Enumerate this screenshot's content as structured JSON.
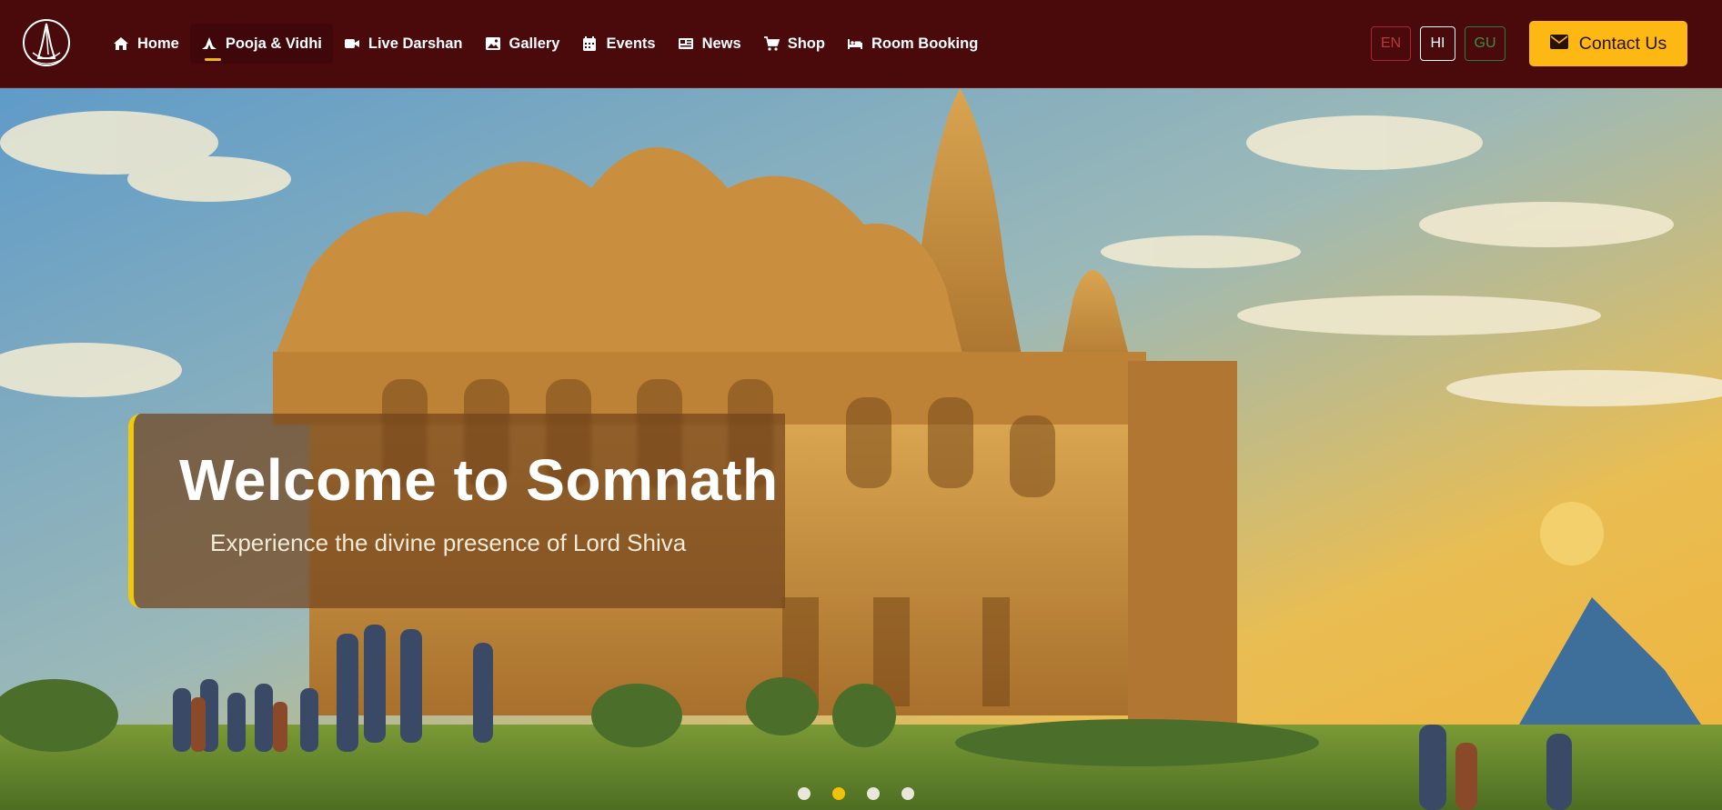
{
  "nav": {
    "items": [
      {
        "label": "Home",
        "icon": "home-icon"
      },
      {
        "label": "Pooja & Vidhi",
        "icon": "pray-icon"
      },
      {
        "label": "Live Darshan",
        "icon": "video-icon"
      },
      {
        "label": "Gallery",
        "icon": "image-icon"
      },
      {
        "label": "Events",
        "icon": "calendar-icon"
      },
      {
        "label": "News",
        "icon": "newspaper-icon"
      },
      {
        "label": "Shop",
        "icon": "cart-icon"
      },
      {
        "label": "Room Booking",
        "icon": "bed-icon"
      }
    ],
    "active_index": 1
  },
  "languages": {
    "en": "EN",
    "hi": "HI",
    "gu": "GU",
    "selected": "HI"
  },
  "contact": {
    "label": "Contact Us",
    "icon": "envelope-icon"
  },
  "hero": {
    "title": "Welcome to Somnath",
    "subtitle": "Experience the divine presence of Lord Shiva",
    "slides_count": 4,
    "active_slide": 1
  },
  "colors": {
    "navbar_bg": "#4a0a0c",
    "accent": "#fdb813",
    "caption_border": "#f2c80f"
  }
}
